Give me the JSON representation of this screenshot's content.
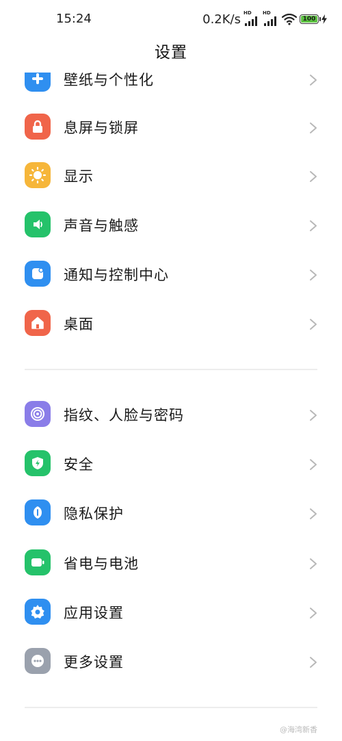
{
  "status_bar": {
    "time": "15:24",
    "net_speed": "0.2K/s",
    "hd_1": "HD",
    "hd_2": "HD",
    "battery": "100"
  },
  "header": {
    "title": "设置"
  },
  "settings": {
    "group1": [
      {
        "label": "壁纸与个性化",
        "icon": "wallpaper-icon",
        "color": "#2f8ff0"
      },
      {
        "label": "息屏与锁屏",
        "icon": "lock-icon",
        "color": "#f0654a"
      },
      {
        "label": "显示",
        "icon": "sun-icon",
        "color": "#f6b63a"
      },
      {
        "label": "声音与触感",
        "icon": "speaker-icon",
        "color": "#25c26a"
      },
      {
        "label": "通知与控制中心",
        "icon": "notification-icon",
        "color": "#2f8ff0"
      },
      {
        "label": "桌面",
        "icon": "home-icon",
        "color": "#f0654a"
      }
    ],
    "group2": [
      {
        "label": "指纹、人脸与密码",
        "icon": "fingerprint-icon",
        "color": "#8a7de8"
      },
      {
        "label": "安全",
        "icon": "shield-icon",
        "color": "#25c26a"
      },
      {
        "label": "隐私保护",
        "icon": "privacy-icon",
        "color": "#2f8ff0"
      },
      {
        "label": "省电与电池",
        "icon": "battery-icon",
        "color": "#25c26a"
      },
      {
        "label": "应用设置",
        "icon": "gear-icon",
        "color": "#2f8ff0"
      },
      {
        "label": "更多设置",
        "icon": "more-icon",
        "color": "#9aa1ad"
      }
    ]
  },
  "watermark": "@海湾新香"
}
